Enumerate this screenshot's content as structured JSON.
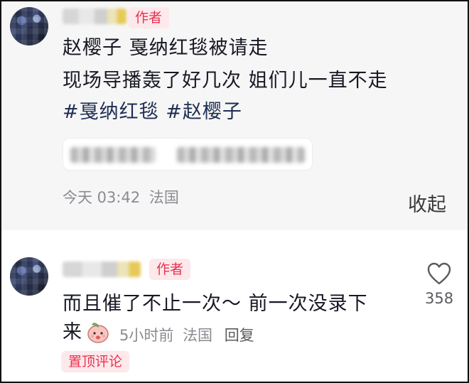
{
  "comment1": {
    "badge": "作者",
    "line1": "赵樱子 戛纳红毯被请走",
    "line2": "现场导播轰了好几次 姐们儿一直不走",
    "tag1": "#戛纳红毯",
    "tag2": "#赵樱子",
    "time": "今天 03:42",
    "location": "法国",
    "collapse_label": "收起"
  },
  "comment2": {
    "badge": "作者",
    "line1": "而且催了不止一次～ 前一次没录下",
    "line2": "来",
    "time": "5小时前",
    "location": "法国",
    "reply_label": "回复",
    "like_count": "358",
    "pin_label": "置顶评论"
  },
  "icons": {
    "heart": "heart-outline-icon",
    "emoji": "peach-face-emoji"
  },
  "colors": {
    "badge_text": "#e8334f",
    "badge_bg": "#fde8ec",
    "hashtag": "#1e2d52",
    "meta": "#8a8b91"
  }
}
